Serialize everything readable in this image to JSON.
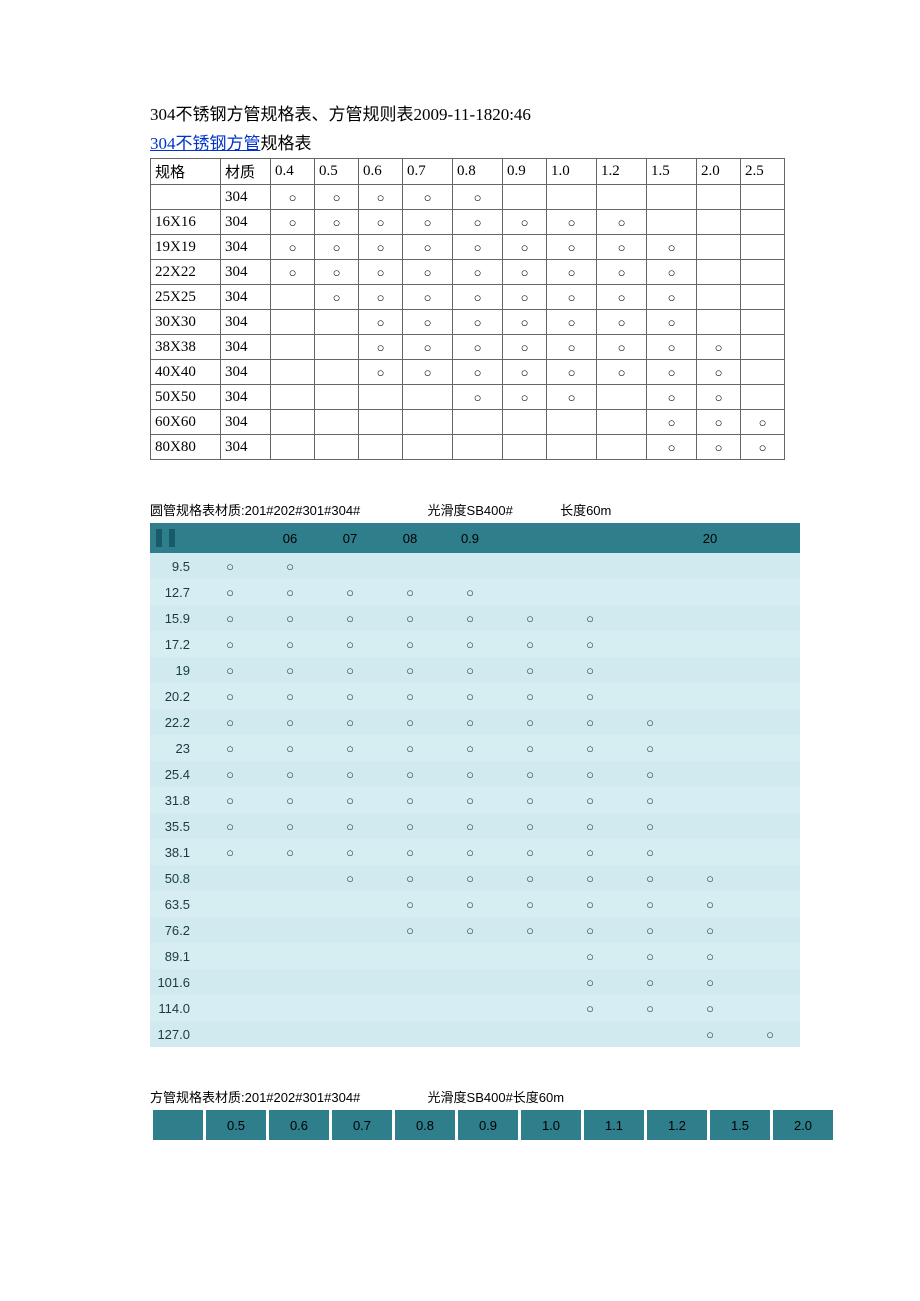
{
  "title": "304不锈钢方管规格表、方管规则表2009-11-1820:46",
  "subtitle_link": "304不锈钢方管",
  "subtitle_rest": "规格表",
  "table1": {
    "headers": [
      "规格",
      "材质",
      "0.4",
      "0.5",
      "0.6",
      "0.7",
      "0.8",
      "0.9",
      "1.0",
      "1.2",
      "1.5",
      "2.0",
      "2.5"
    ],
    "rows": [
      {
        "spec": "",
        "mat": "304",
        "marks": [
          1,
          1,
          1,
          1,
          1,
          0,
          0,
          0,
          0,
          0,
          0
        ]
      },
      {
        "spec": "16X16",
        "mat": "304",
        "marks": [
          1,
          1,
          1,
          1,
          1,
          1,
          1,
          1,
          0,
          0,
          0
        ]
      },
      {
        "spec": "19X19",
        "mat": "304",
        "marks": [
          1,
          1,
          1,
          1,
          1,
          1,
          1,
          1,
          1,
          0,
          0
        ]
      },
      {
        "spec": "22X22",
        "mat": "304",
        "marks": [
          1,
          1,
          1,
          1,
          1,
          1,
          1,
          1,
          1,
          0,
          0
        ]
      },
      {
        "spec": "25X25",
        "mat": "304",
        "marks": [
          0,
          1,
          1,
          1,
          1,
          1,
          1,
          1,
          1,
          0,
          0
        ]
      },
      {
        "spec": "30X30",
        "mat": "304",
        "marks": [
          0,
          0,
          1,
          1,
          1,
          1,
          1,
          1,
          1,
          0,
          0
        ]
      },
      {
        "spec": "38X38",
        "mat": "304",
        "marks": [
          0,
          0,
          1,
          1,
          1,
          1,
          1,
          1,
          1,
          1,
          0
        ]
      },
      {
        "spec": "40X40",
        "mat": "304",
        "marks": [
          0,
          0,
          1,
          1,
          1,
          1,
          1,
          1,
          1,
          1,
          0
        ]
      },
      {
        "spec": "50X50",
        "mat": "304",
        "marks": [
          0,
          0,
          0,
          0,
          1,
          1,
          1,
          0,
          1,
          1,
          0
        ]
      },
      {
        "spec": "60X60",
        "mat": "304",
        "marks": [
          0,
          0,
          0,
          0,
          0,
          0,
          0,
          0,
          1,
          1,
          1
        ]
      },
      {
        "spec": "80X80",
        "mat": "304",
        "marks": [
          0,
          0,
          0,
          0,
          0,
          0,
          0,
          0,
          1,
          1,
          1
        ]
      }
    ]
  },
  "round_caption_parts": {
    "a": "圆管规格表材质:201#202#301#304#",
    "b": "光滑度SB400#",
    "c": "长度60m"
  },
  "round_table": {
    "headers": [
      "",
      "",
      "06",
      "07",
      "08",
      "0.9",
      "",
      "",
      "",
      "20",
      ""
    ],
    "rows": [
      {
        "size": "9.5",
        "m": [
          1,
          1,
          0,
          0,
          0,
          0,
          0,
          0,
          0,
          0
        ]
      },
      {
        "size": "12.7",
        "m": [
          1,
          1,
          1,
          1,
          1,
          0,
          0,
          0,
          0,
          0
        ]
      },
      {
        "size": "15.9",
        "m": [
          1,
          1,
          1,
          1,
          1,
          1,
          1,
          0,
          0,
          0
        ]
      },
      {
        "size": "17.2",
        "m": [
          1,
          1,
          1,
          1,
          1,
          1,
          1,
          0,
          0,
          0
        ]
      },
      {
        "size": "19",
        "m": [
          1,
          1,
          1,
          1,
          1,
          1,
          1,
          0,
          0,
          0
        ]
      },
      {
        "size": "20.2",
        "m": [
          1,
          1,
          1,
          1,
          1,
          1,
          1,
          0,
          0,
          0
        ]
      },
      {
        "size": "22.2",
        "m": [
          1,
          1,
          1,
          1,
          1,
          1,
          1,
          1,
          0,
          0
        ]
      },
      {
        "size": "23",
        "m": [
          1,
          1,
          1,
          1,
          1,
          1,
          1,
          1,
          0,
          0
        ]
      },
      {
        "size": "25.4",
        "m": [
          1,
          1,
          1,
          1,
          1,
          1,
          1,
          1,
          0,
          0
        ]
      },
      {
        "size": "31.8",
        "m": [
          1,
          1,
          1,
          1,
          1,
          1,
          1,
          1,
          0,
          0
        ]
      },
      {
        "size": "35.5",
        "m": [
          1,
          1,
          1,
          1,
          1,
          1,
          1,
          1,
          0,
          0
        ]
      },
      {
        "size": "38.1",
        "m": [
          1,
          1,
          1,
          1,
          1,
          1,
          1,
          1,
          0,
          0
        ]
      },
      {
        "size": "50.8",
        "m": [
          0,
          0,
          1,
          1,
          1,
          1,
          1,
          1,
          1,
          0
        ]
      },
      {
        "size": "63.5",
        "m": [
          0,
          0,
          0,
          1,
          1,
          1,
          1,
          1,
          1,
          0
        ]
      },
      {
        "size": "76.2",
        "m": [
          0,
          0,
          0,
          1,
          1,
          1,
          1,
          1,
          1,
          0
        ]
      },
      {
        "size": "89.1",
        "m": [
          0,
          0,
          0,
          0,
          0,
          0,
          1,
          1,
          1,
          0
        ]
      },
      {
        "size": "101.6",
        "m": [
          0,
          0,
          0,
          0,
          0,
          0,
          1,
          1,
          1,
          0
        ]
      },
      {
        "size": "114.0",
        "m": [
          0,
          0,
          0,
          0,
          0,
          0,
          1,
          1,
          1,
          0
        ]
      },
      {
        "size": "127.0",
        "m": [
          0,
          0,
          0,
          0,
          0,
          0,
          0,
          0,
          1,
          1
        ]
      }
    ]
  },
  "square_caption_parts": {
    "a": "方管规格表材质:201#202#301#304#",
    "b": "光滑度SB400#长度60m"
  },
  "square_header": {
    "headers": [
      "",
      "0.5",
      "0.6",
      "0.7",
      "0.8",
      "0.9",
      "1.0",
      "1.1",
      "1.2",
      "1.5",
      "2.0"
    ]
  },
  "mark_char": "○"
}
